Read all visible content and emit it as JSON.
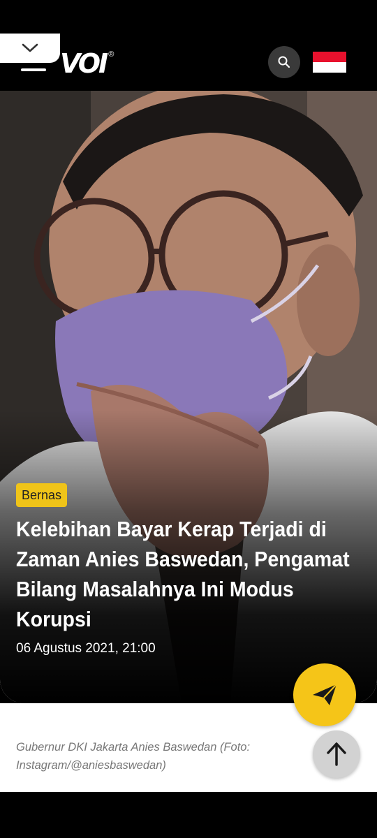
{
  "header": {
    "logo_text": "VOI",
    "logo_mark": "®",
    "search_icon": "search-icon",
    "language_flag": "indonesia-flag",
    "toggle_icon": "chevron-down-icon"
  },
  "article": {
    "category": "Bernas",
    "title": "Kelebihan Bayar Kerap Terjadi di Zaman Anies Baswedan, Pengamat Bilang Masalahnya Ini Modus Korupsi",
    "date": "06 Agustus 2021, 21:00",
    "caption": "Gubernur DKI Jakarta Anies Baswedan (Foto: Instagram/@aniesbaswedan)"
  },
  "actions": {
    "share_icon": "send-icon",
    "top_icon": "arrow-up-icon"
  },
  "colors": {
    "accent": "#f5c518",
    "badge": "#f0c419",
    "flag_red": "#e8112d"
  }
}
